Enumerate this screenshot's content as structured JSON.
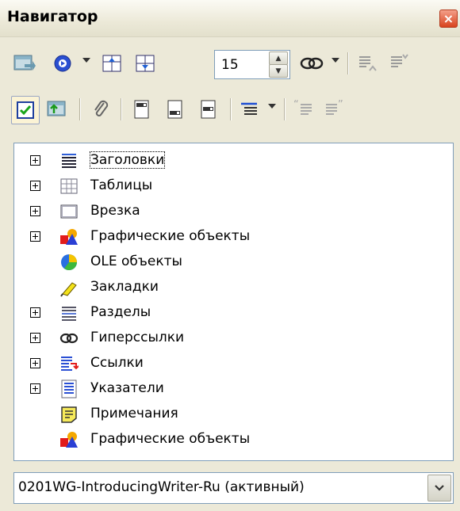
{
  "window": {
    "title": "Навигатор",
    "close_glyph": "×"
  },
  "toolbar_row1": {
    "buttons": [
      {
        "icon": "content-view-icon"
      },
      {
        "icon": "navigation-icon",
        "has_dropdown": true
      },
      {
        "icon": "previous-icon"
      },
      {
        "icon": "next-icon"
      },
      {
        "icon": "drag-mode-icon",
        "has_dropdown": true
      },
      {
        "icon": "promote-level-icon"
      },
      {
        "icon": "demote-level-icon"
      }
    ],
    "page_number": "15"
  },
  "toolbar_row2": {
    "buttons": [
      {
        "icon": "list-box-toggle-icon",
        "active": true
      },
      {
        "icon": "content-view-icon"
      },
      {
        "icon": "set-reminder-icon"
      },
      {
        "icon": "header-icon"
      },
      {
        "icon": "footer-icon"
      },
      {
        "icon": "anchor-to-text-icon"
      },
      {
        "icon": "heading-levels-icon",
        "has_dropdown": true
      },
      {
        "icon": "promote-chapter-icon"
      },
      {
        "icon": "demote-chapter-icon"
      }
    ]
  },
  "tree": {
    "items": [
      {
        "label": "Заголовки",
        "icon": "headings-icon",
        "expandable": true,
        "focused": true
      },
      {
        "label": "Таблицы",
        "icon": "tables-icon",
        "expandable": true
      },
      {
        "label": "Врезка",
        "icon": "frame-icon",
        "expandable": true
      },
      {
        "label": "Графические объекты",
        "icon": "graphics-icon",
        "expandable": true
      },
      {
        "label": "OLE объекты",
        "icon": "ole-objects-icon",
        "expandable": false
      },
      {
        "label": "Закладки",
        "icon": "bookmarks-icon",
        "expandable": false
      },
      {
        "label": "Разделы",
        "icon": "sections-icon",
        "expandable": true
      },
      {
        "label": "Гиперссылки",
        "icon": "hyperlinks-icon",
        "expandable": true
      },
      {
        "label": "Ссылки",
        "icon": "references-icon",
        "expandable": true
      },
      {
        "label": "Указатели",
        "icon": "indexes-icon",
        "expandable": true
      },
      {
        "label": "Примечания",
        "icon": "comments-icon",
        "expandable": false
      },
      {
        "label": "Графические объекты",
        "icon": "drawing-objects-icon",
        "expandable": false
      }
    ]
  },
  "document_selector": {
    "value": "0201WG-IntroducingWriter-Ru (активный)"
  },
  "colors": {
    "window_bg": "#ece9d8",
    "close_button": "#d8421d",
    "field_border": "#7f9db9"
  }
}
